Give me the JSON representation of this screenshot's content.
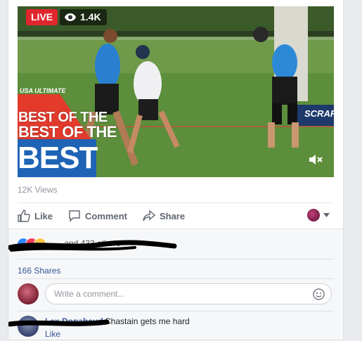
{
  "video": {
    "live_label": "LIVE",
    "viewer_count": "1.4K",
    "brand_small": "USA ULTIMATE",
    "brand_line1": "BEST OF THE",
    "brand_line2": "BEST OF THE",
    "brand_big": "BEST",
    "banner_text": "SCRAFT"
  },
  "views_text": "12K Views",
  "actions": {
    "like": "Like",
    "comment": "Comment",
    "share": "Share"
  },
  "summary": {
    "reactions_text": "… and 433 others",
    "shares_text": "166 Shares",
    "comment_placeholder": "Write a comment..."
  },
  "comment": {
    "author": "Lex Donabaud",
    "text": "Chastain gets me hard",
    "like_label": "Like"
  },
  "colors": {
    "live_red": "#e0262d",
    "fb_blue": "#385898",
    "brand_blue": "#1e63b5"
  }
}
